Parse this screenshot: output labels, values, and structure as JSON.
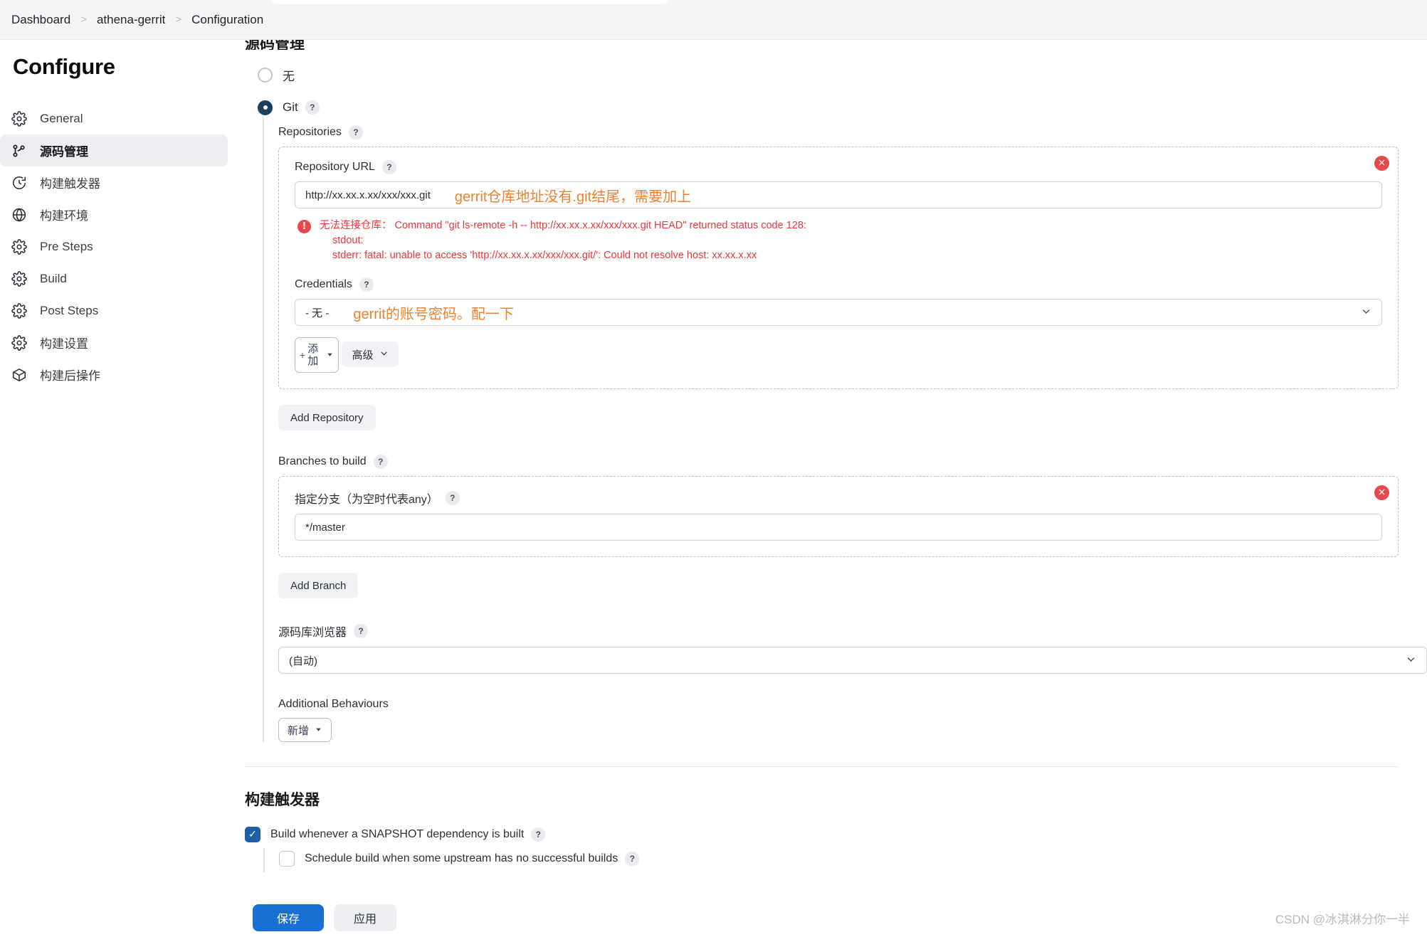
{
  "breadcrumb": {
    "items": [
      "Dashboard",
      "athena-gerrit",
      "Configuration"
    ],
    "separator": ">"
  },
  "sidebar": {
    "title": "Configure",
    "items": [
      {
        "label": "General",
        "icon": "gear-icon",
        "active": false
      },
      {
        "label": "源码管理",
        "icon": "branch-icon",
        "active": true
      },
      {
        "label": "构建触发器",
        "icon": "clock-icon",
        "active": false
      },
      {
        "label": "构建环境",
        "icon": "globe-icon",
        "active": false
      },
      {
        "label": "Pre Steps",
        "icon": "gear-icon",
        "active": false
      },
      {
        "label": "Build",
        "icon": "gear-icon",
        "active": false
      },
      {
        "label": "Post Steps",
        "icon": "gear-icon",
        "active": false
      },
      {
        "label": "构建设置",
        "icon": "gear-icon",
        "active": false
      },
      {
        "label": "构建后操作",
        "icon": "package-icon",
        "active": false
      }
    ]
  },
  "scm": {
    "heading": "源码管理",
    "options": [
      {
        "label": "无",
        "selected": false,
        "help": false
      },
      {
        "label": "Git",
        "selected": true,
        "help": true
      }
    ],
    "help_glyph": "?",
    "repositories_label": "Repositories",
    "repository": {
      "url_label": "Repository URL",
      "url_value": "http://xx.xx.x.xx/xxx/xxx.git",
      "url_annotation": "gerrit仓库地址没有.git结尾，需要加上",
      "error": {
        "icon_glyph": "!",
        "line1": "无法连接仓库： Command \"git ls-remote -h -- http://xx.xx.x.xx/xxx/xxx.git HEAD\" returned status code 128:",
        "line2": "stdout:",
        "line3": "stderr: fatal: unable to access 'http://xx.xx.x.xx/xxx/xxx.git/': Could not resolve host: xx.xx.x.xx"
      },
      "credentials_label": "Credentials",
      "credentials_value": "- 无 -",
      "credentials_annotation": "gerrit的账号密码。配一下",
      "add_credentials_button": "添加",
      "add_credentials_plus": "+",
      "advanced_button": "高级",
      "delete_glyph": "×"
    },
    "add_repository_button": "Add Repository",
    "branches_label": "Branches to build",
    "branch": {
      "specifier_label": "指定分支（为空时代表any）",
      "specifier_value": "*/master",
      "delete_glyph": "×"
    },
    "add_branch_button": "Add Branch",
    "browser_label": "源码库浏览器",
    "browser_value": "(自动)",
    "additional_behaviours_label": "Additional Behaviours",
    "additional_behaviours_button": "新增"
  },
  "triggers": {
    "heading": "构建触发器",
    "items": [
      {
        "label": "Build whenever a SNAPSHOT dependency is built",
        "checked": true,
        "help": true,
        "nested": false
      },
      {
        "label": "Schedule build when some upstream has no successful builds",
        "checked": false,
        "help": true,
        "nested": true
      }
    ]
  },
  "footer": {
    "save_label": "保存",
    "apply_label": "应用",
    "watermark": "CSDN @冰淇淋分你一半"
  },
  "colors": {
    "accent_blue": "#1a6fd4",
    "radio_selected": "#1c3f5e",
    "error_red": "#f0353a",
    "annotation_orange": "#f08030",
    "sidebar_active_bg": "#eceef2"
  }
}
